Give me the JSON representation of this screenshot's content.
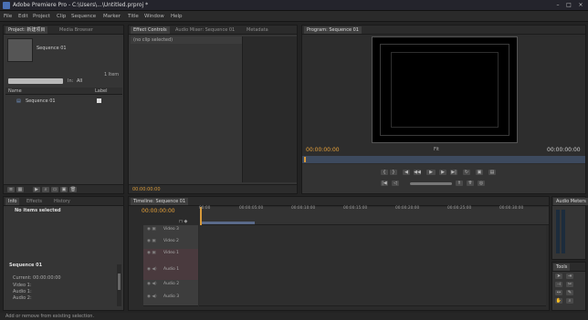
{
  "window": {
    "title": "Adobe Premiere Pro - C:\\Users\\...\\Untitled.prproj *",
    "controls": [
      "–",
      "□",
      "×"
    ]
  },
  "menu": [
    "File",
    "Edit",
    "Project",
    "Clip",
    "Sequence",
    "Marker",
    "Title",
    "Window",
    "Help"
  ],
  "project_panel": {
    "tabs": [
      "Project: 新建项目",
      "Media Browser"
    ],
    "item_name": "Sequence 01",
    "item_count": "1 Item",
    "in_label": "In:",
    "in_value": "All",
    "column_name": "Name",
    "column_label": "Label",
    "items": [
      {
        "name": "Sequence 01"
      }
    ]
  },
  "effect_controls": {
    "tabs": [
      "Effect Controls",
      "Audio Mixer: Sequence 01",
      "Metadata"
    ],
    "label": "(no clip selected)",
    "timecode": "00:00:00:00"
  },
  "program_monitor": {
    "tab": "Program: Sequence 01",
    "timecode_left": "00:00:00:00",
    "timecode_right": "00:00:00:00",
    "fit": "Fit",
    "accent": "#e8a23a"
  },
  "info_panel": {
    "tabs": [
      "Info",
      "Effects",
      "History"
    ],
    "no_items": "No items selected",
    "sequence": "Sequence 01",
    "current_label": "Current: 00:00:00:00",
    "lines": [
      "Video 1:",
      "Audio 1:",
      "Audio 2:"
    ]
  },
  "timeline": {
    "tab": "Timeline: Sequence 01",
    "timecode": "00:00:00:00",
    "ruler": [
      "00:00",
      "00:00:05:00",
      "00:00:10:00",
      "00:00:15:00",
      "00:00:20:00",
      "00:00:25:00",
      "00:00:30:00",
      "00:00:35:00"
    ],
    "tracks": [
      "Video 3",
      "Video 2",
      "Video 1",
      "Audio 1",
      "Audio 2",
      "Audio 3"
    ],
    "track_icons": [
      "◉ ▣",
      "◉ ▣",
      "◉ ▣",
      "◉ ◀)",
      "◉ ◀)",
      "◉ ◀)"
    ]
  },
  "audio_meters": {
    "tab": "Audio Meters"
  },
  "tools": {
    "tab": "Tools"
  },
  "status_bar": "Add or remove from existing selection."
}
